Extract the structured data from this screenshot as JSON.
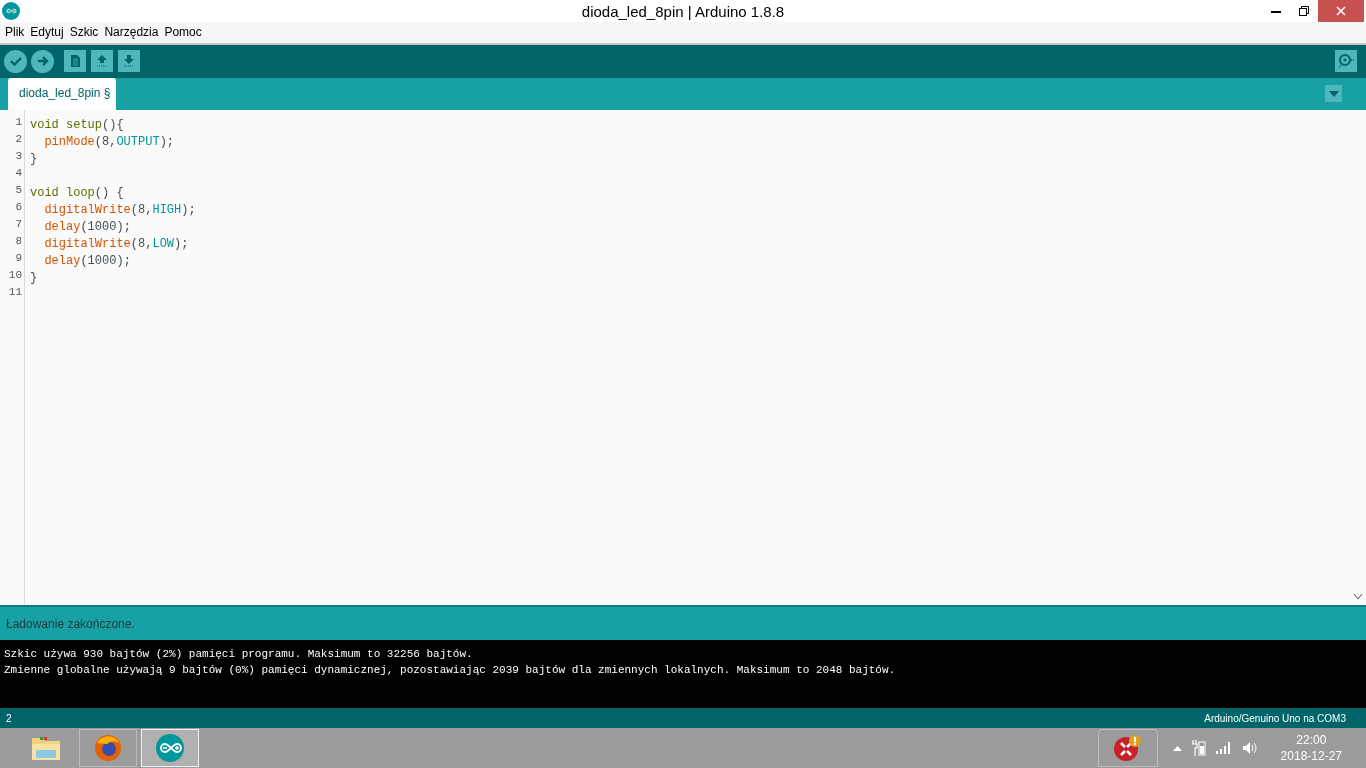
{
  "window": {
    "title": "dioda_led_8pin | Arduino 1.8.8"
  },
  "menu": [
    "Plik",
    "Edytuj",
    "Szkic",
    "Narzędzia",
    "Pomoc"
  ],
  "toolbar": [
    {
      "kind": "verify"
    },
    {
      "kind": "upload"
    },
    {
      "kind": "new"
    },
    {
      "kind": "open"
    },
    {
      "kind": "save"
    }
  ],
  "tabs": [
    {
      "label": "dioda_led_8pin §",
      "selected": true
    }
  ],
  "editor": {
    "lines": [
      {
        "number": "1",
        "tokens": [
          {
            "text": "void setup",
            "kind": "keyword"
          },
          {
            "text": "(){",
            "kind": "plain"
          }
        ]
      },
      {
        "number": "2",
        "tokens": [
          {
            "text": "  pinMode",
            "kind": "function"
          },
          {
            "text": "(8,",
            "kind": "plain"
          },
          {
            "text": "OUTPUT",
            "kind": "constant"
          },
          {
            "text": ");",
            "kind": "plain"
          }
        ]
      },
      {
        "number": "3",
        "tokens": [
          {
            "text": "}",
            "kind": "plain"
          }
        ]
      },
      {
        "number": "4"
      },
      {
        "number": "5",
        "tokens": [
          {
            "text": "void loop",
            "kind": "keyword"
          },
          {
            "text": "() {",
            "kind": "plain"
          }
        ]
      },
      {
        "number": "6",
        "tokens": [
          {
            "text": "  digitalWrite",
            "kind": "function"
          },
          {
            "text": "(8,",
            "kind": "plain"
          },
          {
            "text": "HIGH",
            "kind": "constant"
          },
          {
            "text": ");",
            "kind": "plain"
          }
        ]
      },
      {
        "number": "7",
        "tokens": [
          {
            "text": "  delay",
            "kind": "function"
          },
          {
            "text": "(1000);",
            "kind": "plain"
          }
        ]
      },
      {
        "number": "8",
        "tokens": [
          {
            "text": "  digitalWrite",
            "kind": "function"
          },
          {
            "text": "(8,",
            "kind": "plain"
          },
          {
            "text": "LOW",
            "kind": "constant"
          },
          {
            "text": ");",
            "kind": "plain"
          }
        ]
      },
      {
        "number": "9",
        "tokens": [
          {
            "text": "  delay",
            "kind": "function"
          },
          {
            "text": "(1000);",
            "kind": "plain"
          }
        ]
      },
      {
        "number": "10",
        "tokens": [
          {
            "text": "}",
            "kind": "plain"
          }
        ]
      },
      {
        "number": "11"
      }
    ]
  },
  "status": "Ładowanie zakończone.",
  "console": [
    "Szkic używa 930 bajtów (2%) pamięci programu. Maksimum to 32256 bajtów.",
    "Zmienne globalne używają 9 bajtów (0%) pamięci dynamicznej, pozostawiając 2039 bajtów dla zmiennych lokalnych. Maksimum to 2048 bajtów."
  ],
  "footer": {
    "line": "2",
    "board": "Arduino/Genuino Uno na COM3"
  },
  "taskbar": {
    "apps": [
      {
        "kind": "folder",
        "selected": false
      },
      {
        "kind": "browser",
        "selected": false
      },
      {
        "kind": "arduino",
        "selected": true
      }
    ],
    "time": "22:00",
    "date": "2018-12-27"
  }
}
